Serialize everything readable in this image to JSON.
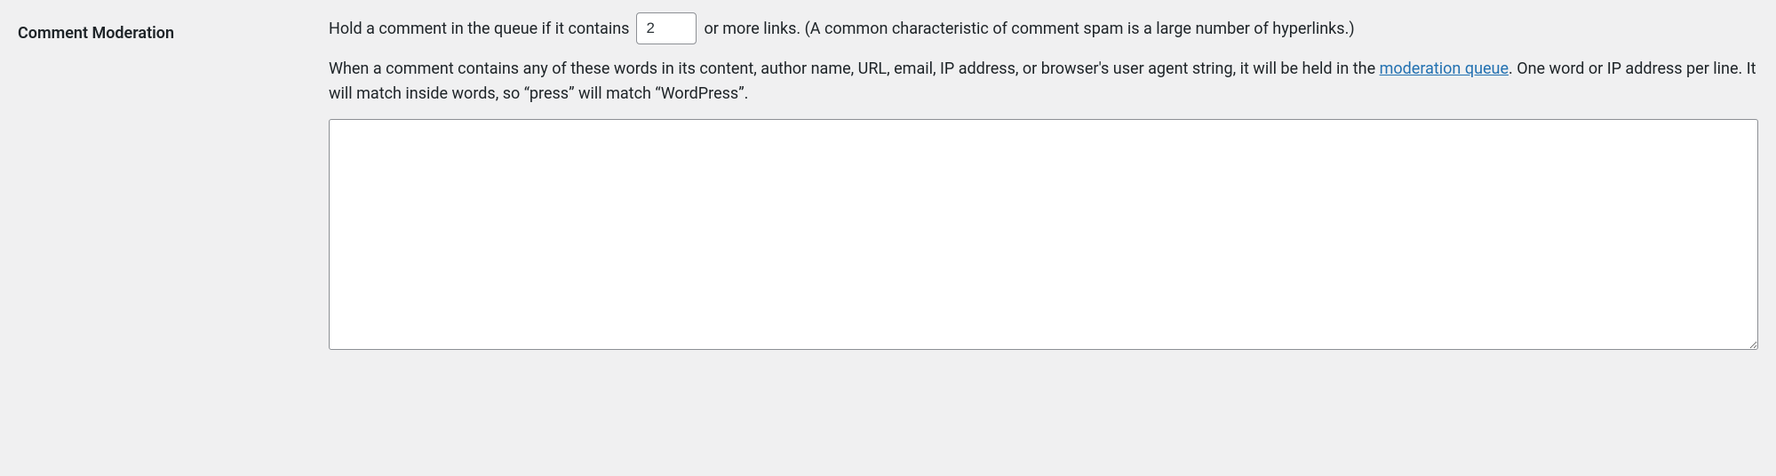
{
  "section": {
    "title": "Comment Moderation"
  },
  "line1": {
    "before": "Hold a comment in the queue if it contains",
    "max_links_value": "2",
    "after": "or more links. (A common characteristic of comment spam is a large number of hyperlinks.)"
  },
  "desc": {
    "part1": "When a comment contains any of these words in its content, author name, URL, email, IP address, or browser's user agent string, it will be held in the ",
    "link_text": "moderation queue",
    "part2": ". One word or IP address per line. It will match inside words, so “press” will match “WordPress”."
  },
  "textarea": {
    "value": ""
  }
}
